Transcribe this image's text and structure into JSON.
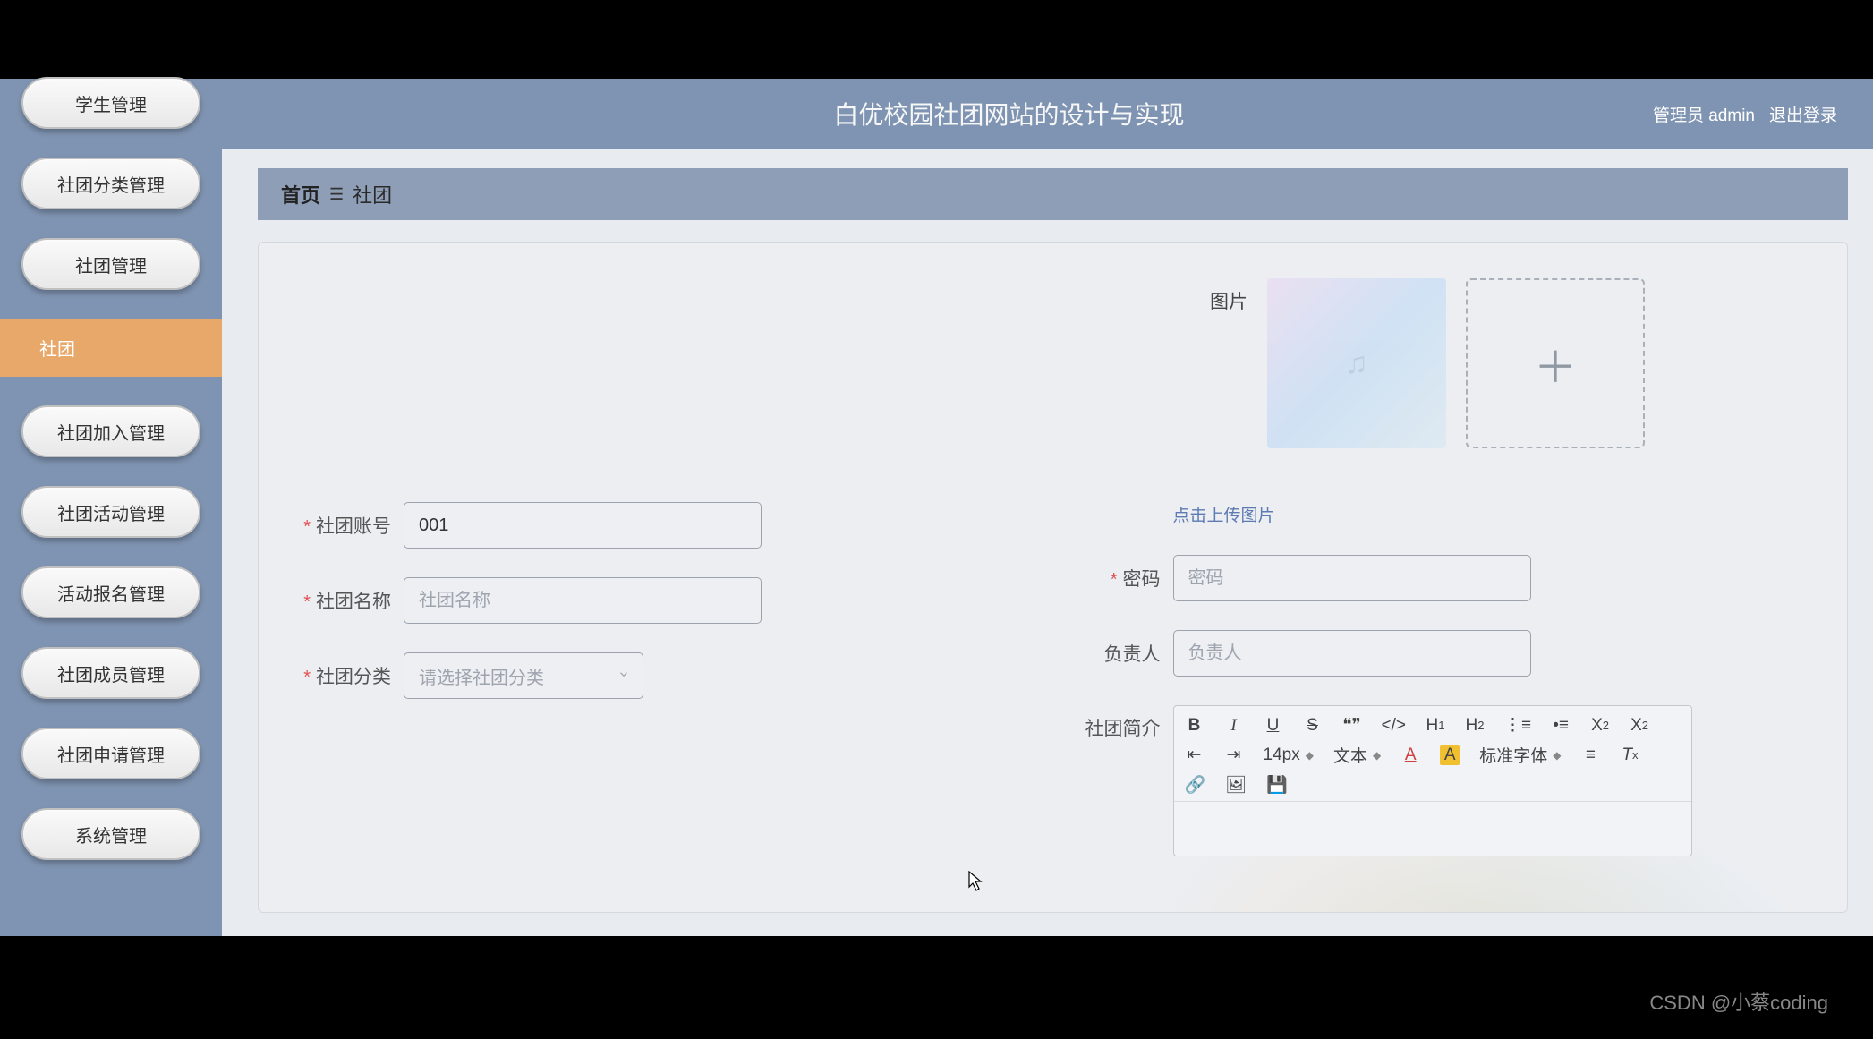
{
  "header": {
    "title": "白优校园社团网站的设计与实现",
    "user_label": "管理员 admin",
    "logout_label": "退出登录"
  },
  "sidebar": {
    "items": [
      {
        "label": "学生管理",
        "active": false
      },
      {
        "label": "社团分类管理",
        "active": false
      },
      {
        "label": "社团管理",
        "active": false
      },
      {
        "label": "社团",
        "active": true
      },
      {
        "label": "社团加入管理",
        "active": false
      },
      {
        "label": "社团活动管理",
        "active": false
      },
      {
        "label": "活动报名管理",
        "active": false
      },
      {
        "label": "社团成员管理",
        "active": false
      },
      {
        "label": "社团申请管理",
        "active": false
      },
      {
        "label": "系统管理",
        "active": false
      }
    ]
  },
  "breadcrumb": {
    "home": "首页",
    "sep_icon": "hamburger-icon",
    "current": "社团"
  },
  "form": {
    "image_label": "图片",
    "upload_hint": "点击上传图片",
    "fields": {
      "account": {
        "label": "社团账号",
        "value": "001",
        "placeholder": "社团账号",
        "required": true
      },
      "name": {
        "label": "社团名称",
        "value": "",
        "placeholder": "社团名称",
        "required": true
      },
      "category": {
        "label": "社团分类",
        "value": "",
        "placeholder": "请选择社团分类",
        "required": true
      },
      "password": {
        "label": "密码",
        "value": "",
        "placeholder": "密码",
        "required": true
      },
      "leader": {
        "label": "负责人",
        "value": "",
        "placeholder": "负责人",
        "required": false
      },
      "intro": {
        "label": "社团简介",
        "required": false
      }
    }
  },
  "rte": {
    "font_size_label": "14px",
    "text_label": "文本",
    "font_family_label": "标准字体"
  },
  "watermark": "CSDN @小蔡coding"
}
